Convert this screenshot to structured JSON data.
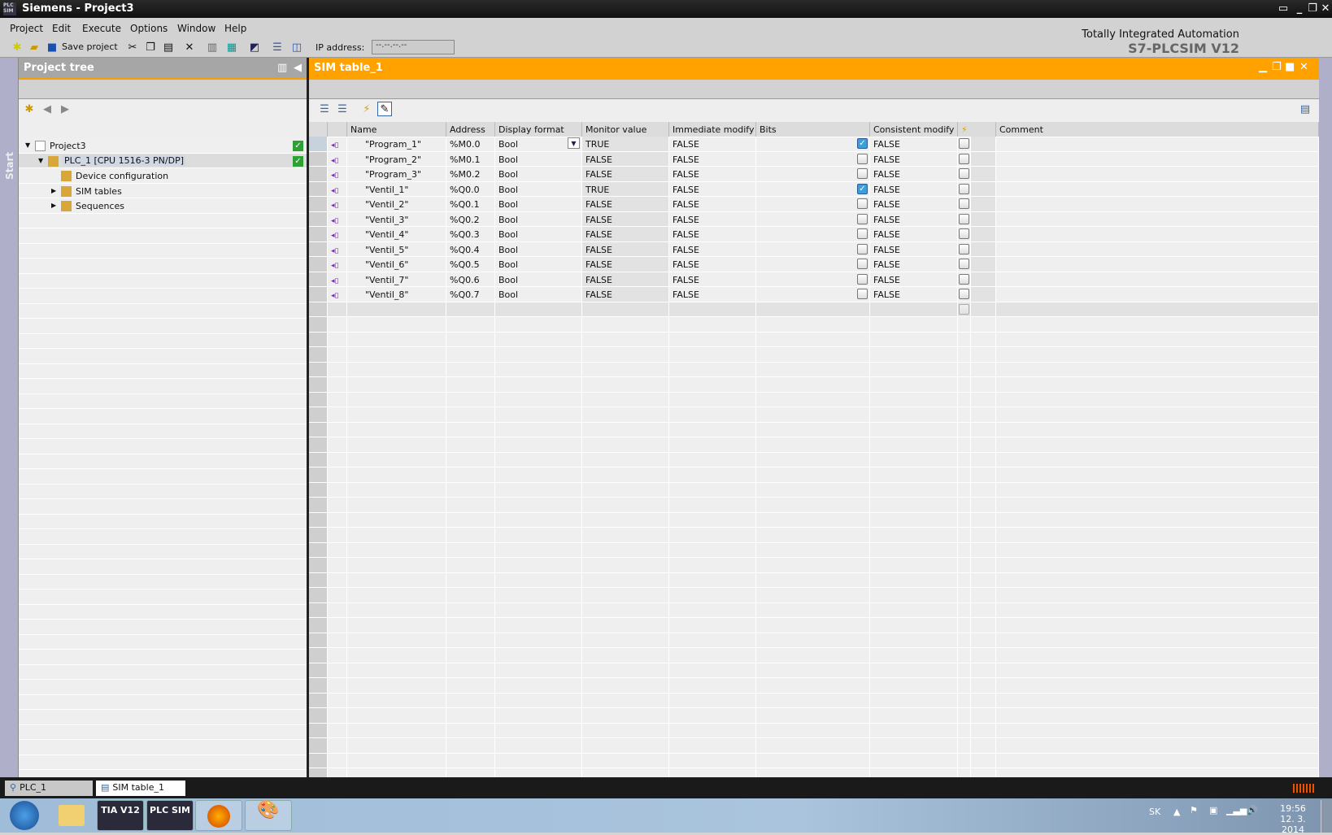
{
  "window": {
    "title": "Siemens  -  Project3",
    "logo": "PLC SIM"
  },
  "menu": [
    "Project",
    "Edit",
    "Execute",
    "Options",
    "Window",
    "Help"
  ],
  "toolbar": {
    "save_label": "Save project",
    "ip_label": "IP address:",
    "ip_value": "--.--.--.--"
  },
  "brand": {
    "line1": "Totally Integrated Automation",
    "line2": "S7-PLCSIM V12"
  },
  "start_label": "Start",
  "tree": {
    "title": "Project tree",
    "items": [
      {
        "label": "Project3",
        "icon": "project-icon",
        "expander": "▼",
        "level": 0,
        "status": true
      },
      {
        "label": "PLC_1 [CPU 1516-3 PN/DP]",
        "icon": "plc-icon",
        "expander": "▼",
        "level": 1,
        "status": true,
        "selected": true
      },
      {
        "label": "Device configuration",
        "icon": "device-config-icon",
        "expander": "",
        "level": 2
      },
      {
        "label": "SIM tables",
        "icon": "sim-tables-folder-icon",
        "expander": "▶",
        "level": 2
      },
      {
        "label": "Sequences",
        "icon": "sequences-folder-icon",
        "expander": "▶",
        "level": 2
      }
    ]
  },
  "editor": {
    "title": "SIM table_1",
    "columns": [
      "Name",
      "Address",
      "Display format",
      "Monitor value",
      "Immediate modify",
      "Bits",
      "Consistent modify",
      "⚡",
      "Comment"
    ],
    "rows": [
      {
        "name": "\"Program_1\"",
        "address": "%M0.0",
        "format": "Bool",
        "monitor": "TRUE",
        "immediate": "FALSE",
        "bits": true,
        "consistent": "FALSE",
        "trigger": false
      },
      {
        "name": "\"Program_2\"",
        "address": "%M0.1",
        "format": "Bool",
        "monitor": "FALSE",
        "immediate": "FALSE",
        "bits": false,
        "consistent": "FALSE",
        "trigger": false
      },
      {
        "name": "\"Program_3\"",
        "address": "%M0.2",
        "format": "Bool",
        "monitor": "FALSE",
        "immediate": "FALSE",
        "bits": false,
        "consistent": "FALSE",
        "trigger": false
      },
      {
        "name": "\"Ventil_1\"",
        "address": "%Q0.0",
        "format": "Bool",
        "monitor": "TRUE",
        "immediate": "FALSE",
        "bits": true,
        "consistent": "FALSE",
        "trigger": false
      },
      {
        "name": "\"Ventil_2\"",
        "address": "%Q0.1",
        "format": "Bool",
        "monitor": "FALSE",
        "immediate": "FALSE",
        "bits": false,
        "consistent": "FALSE",
        "trigger": false
      },
      {
        "name": "\"Ventil_3\"",
        "address": "%Q0.2",
        "format": "Bool",
        "monitor": "FALSE",
        "immediate": "FALSE",
        "bits": false,
        "consistent": "FALSE",
        "trigger": false
      },
      {
        "name": "\"Ventil_4\"",
        "address": "%Q0.3",
        "format": "Bool",
        "monitor": "FALSE",
        "immediate": "FALSE",
        "bits": false,
        "consistent": "FALSE",
        "trigger": false
      },
      {
        "name": "\"Ventil_5\"",
        "address": "%Q0.4",
        "format": "Bool",
        "monitor": "FALSE",
        "immediate": "FALSE",
        "bits": false,
        "consistent": "FALSE",
        "trigger": false
      },
      {
        "name": "\"Ventil_6\"",
        "address": "%Q0.5",
        "format": "Bool",
        "monitor": "FALSE",
        "immediate": "FALSE",
        "bits": false,
        "consistent": "FALSE",
        "trigger": false
      },
      {
        "name": "\"Ventil_7\"",
        "address": "%Q0.6",
        "format": "Bool",
        "monitor": "FALSE",
        "immediate": "FALSE",
        "bits": false,
        "consistent": "FALSE",
        "trigger": false
      },
      {
        "name": "\"Ventil_8\"",
        "address": "%Q0.7",
        "format": "Bool",
        "monitor": "FALSE",
        "immediate": "FALSE",
        "bits": false,
        "consistent": "FALSE",
        "trigger": false
      }
    ]
  },
  "editor_tabs": [
    {
      "label": "PLC_1",
      "active": false
    },
    {
      "label": "SIM table_1",
      "active": true
    }
  ],
  "taskbar": {
    "apps": [
      "TIA V12",
      "PLC SIM"
    ],
    "lang": "SK",
    "time": "19:56",
    "date": "12. 3. 2014"
  },
  "colors": {
    "accent": "#ffa200",
    "titlebar": "#101010",
    "check": "#2fa033"
  }
}
